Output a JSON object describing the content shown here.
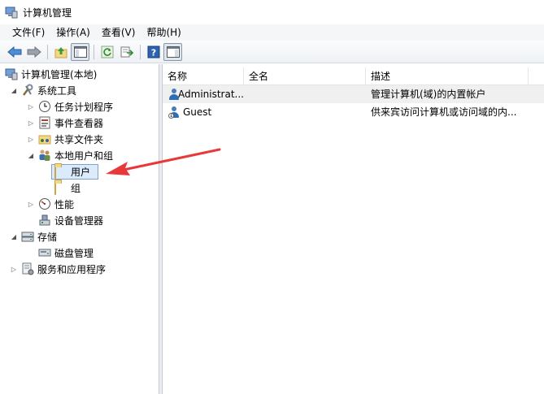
{
  "window": {
    "title": "计算机管理"
  },
  "menu": [
    "文件(F)",
    "操作(A)",
    "查看(V)",
    "帮助(H)"
  ],
  "tree": {
    "root": "计算机管理(本地)",
    "system_tools": "系统工具",
    "task_scheduler": "任务计划程序",
    "event_viewer": "事件查看器",
    "shared_folders": "共享文件夹",
    "local_users_groups": "本地用户和组",
    "users": "用户",
    "groups": "组",
    "performance": "性能",
    "device_manager": "设备管理器",
    "storage": "存储",
    "disk_management": "磁盘管理",
    "services_apps": "服务和应用程序"
  },
  "list": {
    "columns": [
      "名称",
      "全名",
      "描述"
    ],
    "rows": [
      {
        "name": "Administrat...",
        "fullname": "",
        "description": "管理计算机(域)的内置帐户"
      },
      {
        "name": "Guest",
        "fullname": "",
        "description": "供来宾访问计算机或访问域的内..."
      }
    ]
  },
  "colors": {
    "selection": "#dcebfc",
    "annotation_arrow": "#e8383a"
  }
}
